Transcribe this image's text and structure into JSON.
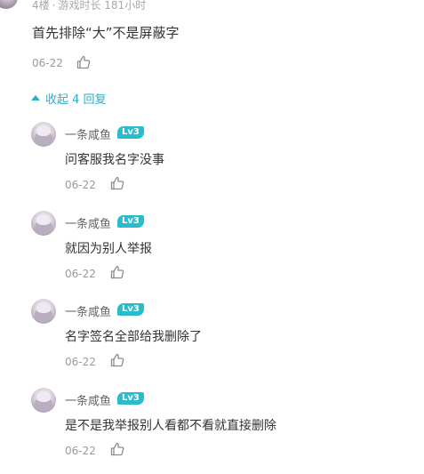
{
  "top_comment": {
    "floor_meta": "4楼",
    "separator": "·",
    "playtime": "游戏时长 181小时",
    "text": "首先排除“大”不是屏蔽字",
    "date": "06-22"
  },
  "collapse_label": "收起 4 回复",
  "replies": [
    {
      "username": "一条咸鱼",
      "level": "Lv3",
      "text": "问客服我名字没事",
      "date": "06-22"
    },
    {
      "username": "一条咸鱼",
      "level": "Lv3",
      "text": "就因为别人举报",
      "date": "06-22"
    },
    {
      "username": "一条咸鱼",
      "level": "Lv3",
      "text": "名字签名全部给我删除了",
      "date": "06-22"
    },
    {
      "username": "一条咸鱼",
      "level": "Lv3",
      "text": "是不是我举报别人看都不看就直接删除",
      "date": "06-22"
    }
  ],
  "colors": {
    "accent": "#27b0c9",
    "level_badge": "#2bbccc",
    "muted": "#9a9a9a",
    "text": "#333333"
  },
  "icons": {
    "like": "thumbs-up-icon",
    "collapse": "triangle-up-icon"
  }
}
